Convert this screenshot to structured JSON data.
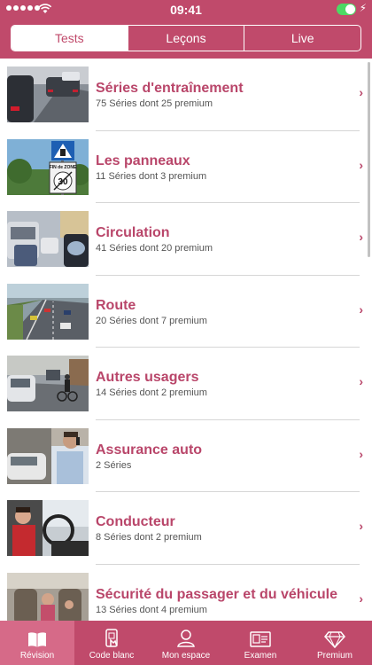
{
  "status": {
    "time": "09:41"
  },
  "segments": [
    {
      "label": "Tests",
      "active": true
    },
    {
      "label": "Leçons",
      "active": false
    },
    {
      "label": "Live",
      "active": false
    }
  ],
  "items": [
    {
      "title": "Séries d'entraînement",
      "subtitle": "75 Séries dont 25 premium"
    },
    {
      "title": "Les panneaux",
      "subtitle": "11 Séries dont 3 premium",
      "sign_text": "FIN de ZONE",
      "sign_number": "30"
    },
    {
      "title": "Circulation",
      "subtitle": "41 Séries dont 20 premium"
    },
    {
      "title": "Route",
      "subtitle": "20 Séries dont 7 premium"
    },
    {
      "title": "Autres usagers",
      "subtitle": "14 Séries dont 2 premium"
    },
    {
      "title": "Assurance auto",
      "subtitle": "2 Séries"
    },
    {
      "title": "Conducteur",
      "subtitle": "8 Séries dont 2 premium"
    },
    {
      "title": "Sécurité du passager et du véhicule",
      "subtitle": "13 Séries dont 4 premium"
    }
  ],
  "tabs": [
    {
      "label": "Révision",
      "icon": "book-icon",
      "active": true
    },
    {
      "label": "Code blanc",
      "icon": "phone-touch-icon",
      "active": false
    },
    {
      "label": "Mon espace",
      "icon": "user-icon",
      "active": false
    },
    {
      "label": "Examen",
      "icon": "id-card-icon",
      "active": false
    },
    {
      "label": "Premium",
      "icon": "diamond-icon",
      "active": false
    }
  ],
  "colors": {
    "brand": "#c04a6b",
    "title": "#b9466a",
    "tab_active": "#d66a88"
  }
}
